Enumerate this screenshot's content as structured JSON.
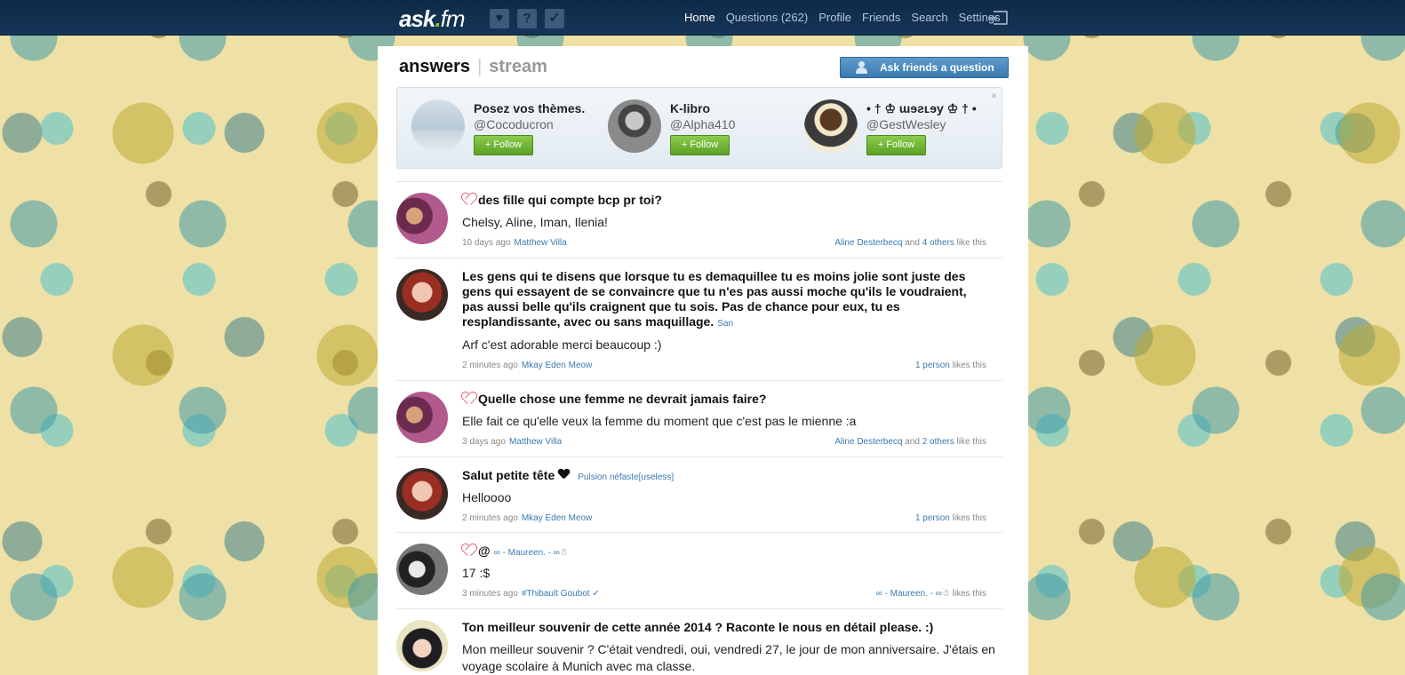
{
  "topbar": {
    "logo_main": "ask",
    "logo_dot": ".",
    "logo_fm": "fm",
    "icons": [
      "heart-icon",
      "question-icon",
      "check-icon"
    ],
    "nav": {
      "home": "Home",
      "questions": "Questions (262)",
      "profile": "Profile",
      "friends": "Friends",
      "search": "Search",
      "settings": "Settings"
    }
  },
  "header": {
    "tab_answers": "answers",
    "tab_separator": "|",
    "tab_stream": "stream",
    "ask_button": "Ask friends a question"
  },
  "suggestions": {
    "close": "×",
    "follow_label": "+ Follow",
    "items": [
      {
        "name": "Posez vos thèmes.",
        "handle": "@Cocoducron"
      },
      {
        "name": "K-libro",
        "handle": "@Alpha410"
      },
      {
        "name": "• † ♔ ɯɘƨʟɘy ♔ † •",
        "handle": "@GestWesley"
      }
    ]
  },
  "feed": [
    {
      "question": "des fille qui compte bcp pr toi?",
      "answer": "Chelsy, Aline, Iman, Ilenia!",
      "time": "10 days ago",
      "author": "Matthew Villa",
      "likes_name": "Aline Desterbecq",
      "likes_and": "and",
      "likes_count": "4 others",
      "likes_suffix": "like this"
    },
    {
      "question": "Les gens qui te disens que lorsque tu es demaquillee tu es moins jolie sont juste des gens qui essayent de se convaincre que tu n'es pas aussi moche qu'ils le voudraient, pas aussi belle qu'ils craignent que tu sois. Pas de chance pour eux, tu es resplandissante, avec ou sans maquillage.",
      "asker": "San",
      "answer": "Arf c'est adorable merci beaucoup :)",
      "time": "2 minutes ago",
      "author": "Mkay Eden Meow",
      "likes_count": "1 person",
      "likes_suffix": "likes this"
    },
    {
      "question": "Quelle chose une femme ne devrait jamais faire?",
      "answer": "Elle fait ce qu'elle veux la femme du moment que c'est pas le mienne :a",
      "time": "3 days ago",
      "author": "Matthew Villa",
      "likes_name": "Aline Desterbecq",
      "likes_and": "and",
      "likes_count": "2 others",
      "likes_suffix": "like this"
    },
    {
      "question": "Salut petite tête",
      "asker": "Pulsion néfaste[useless]",
      "answer": "Helloooo",
      "time": "2 minutes ago",
      "author": "Mkay Eden Meow",
      "likes_count": "1 person",
      "likes_suffix": "likes this"
    },
    {
      "question": "@",
      "asker": "∞ - Maureen. - ∞☃",
      "answer": "17 :$",
      "time": "3 minutes ago",
      "author": "#Thibault Goubot ✓",
      "likes_count": "∞ - Maureen. - ∞☃",
      "likes_suffix": "likes this"
    },
    {
      "question": "Ton meilleur souvenir de cette année 2014 ? Raconte le nous en détail please. :)",
      "answer": "Mon meilleur souvenir ? C'était vendredi, oui, vendredi 27, le jour de mon anniversaire. J'étais en voyage scolaire à Munich avec ma classe."
    }
  ],
  "colors": {
    "topbar": "#153657",
    "link": "#3a7ab0",
    "follow": "#5aa226",
    "heart": "#e45b78"
  }
}
